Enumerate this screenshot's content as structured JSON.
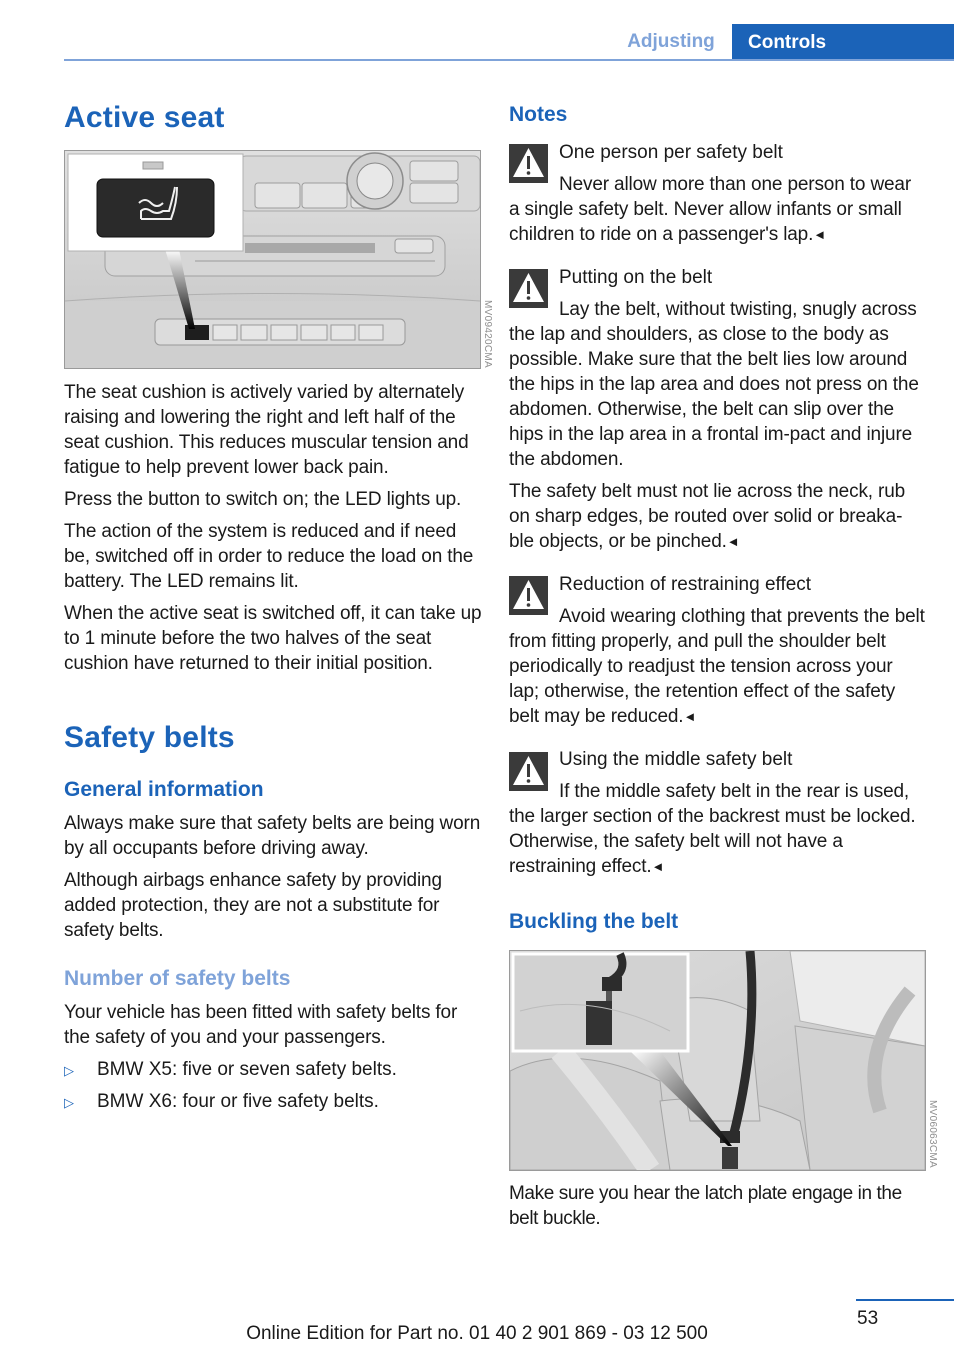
{
  "header": {
    "section_inactive": "Adjusting",
    "section_active": "Controls"
  },
  "left": {
    "active_seat": {
      "title": "Active seat",
      "figure_code": "MV09420CMA",
      "paragraphs": [
        "The seat cushion is actively varied by alternately raising and lowering the right and left half of the seat cushion. This reduces muscular tension and fatigue to help prevent lower back pain.",
        "Press the button to switch on; the LED lights up.",
        "The action of the system is reduced and if need be, switched off in order to reduce the load on the battery. The LED remains lit.",
        "When the active seat is switched off, it can take up to 1 minute before the two halves of the seat cushion have returned to their initial position."
      ]
    },
    "safety_belts": {
      "title": "Safety belts",
      "general_heading": "General information",
      "general_paragraphs": [
        "Always make sure that safety belts are being worn by all occupants before driving away.",
        "Although airbags enhance safety by providing added protection, they are not a substitute for safety belts."
      ],
      "number_heading": "Number of safety belts",
      "number_paragraph": "Your vehicle has been fitted with safety belts for the safety of you and your passengers.",
      "bullets": [
        "BMW X5: five or seven safety belts.",
        "BMW X6: four or five safety belts."
      ],
      "bullet_marker": "▷"
    }
  },
  "right": {
    "notes_heading": "Notes",
    "end_marker": "◄",
    "warnings": [
      {
        "title": "One person per safety belt",
        "body": "Never allow more than one person to wear a single safety belt. Never allow infants or small children to ride on a passenger's lap."
      },
      {
        "title": "Putting on the belt",
        "body": "Lay the belt, without twisting, snugly across the lap and shoulders, as close to the body as possible. Make sure that the belt lies low around the hips in the lap area and does not press on the abdomen. Otherwise, the belt can slip over the hips in the lap area in a frontal im-pact and injure the abdomen.",
        "extra": "The safety belt must not lie across the neck, rub on sharp edges, be routed over solid or breaka-ble objects, or be pinched."
      },
      {
        "title": "Reduction of restraining effect",
        "body": "Avoid wearing clothing that prevents the belt from fitting properly, and pull the shoulder belt periodically to readjust the tension across your lap; otherwise, the retention effect of the safety belt may be reduced."
      },
      {
        "title": "Using the middle safety belt",
        "body": "If the middle safety belt in the rear is used, the larger section of the backrest must be locked. Otherwise, the safety belt will not have a restraining effect."
      }
    ],
    "buckling_heading": "Buckling the belt",
    "buckling_figure_code": "MV06063CMA",
    "buckling_paragraph": "Make sure you hear the latch plate engage in the belt buckle."
  },
  "footer": {
    "page_number": "53",
    "edition_text": "Online Edition for Part no. 01 40 2 901 869 - 03 12 500"
  },
  "colors": {
    "accent": "#1b63b8",
    "accent_light": "#7fa3d9",
    "warning_icon_bg": "#3a3a3a"
  }
}
